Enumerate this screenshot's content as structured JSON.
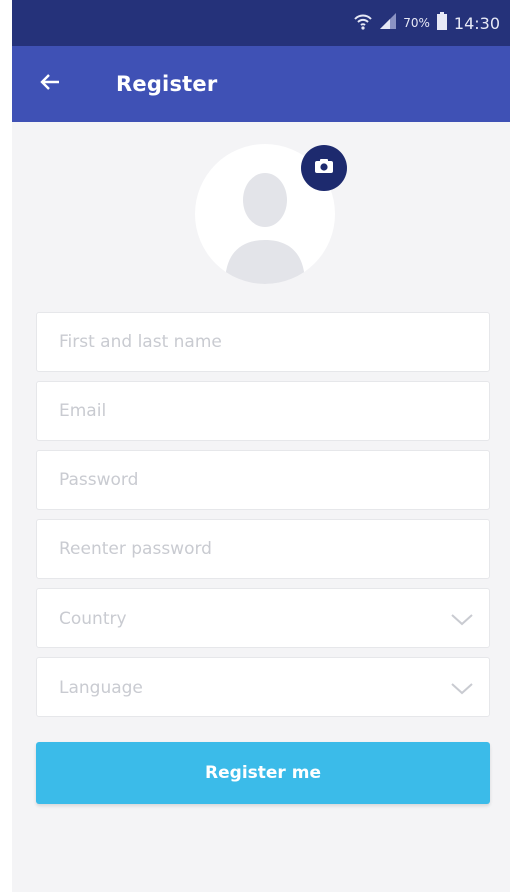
{
  "status_bar": {
    "battery_percent": "70%",
    "time": "14:30",
    "icons": [
      "wifi-icon",
      "signal-icon",
      "battery-icon"
    ]
  },
  "app_bar": {
    "title": "Register",
    "back_icon": "back-arrow-icon"
  },
  "avatar": {
    "placeholder_icon": "person-silhouette-icon",
    "camera_icon": "camera-icon"
  },
  "form": {
    "name_placeholder": "First and last name",
    "email_placeholder": "Email",
    "password_placeholder": "Password",
    "reenter_placeholder": "Reenter password",
    "country_placeholder": "Country",
    "language_placeholder": "Language"
  },
  "submit": {
    "label": "Register me"
  },
  "colors": {
    "status_bar": "#25327a",
    "app_bar": "#3f51b5",
    "camera_badge": "#1d2a6e",
    "primary_button": "#3bbbe9",
    "background": "#f4f4f6"
  }
}
